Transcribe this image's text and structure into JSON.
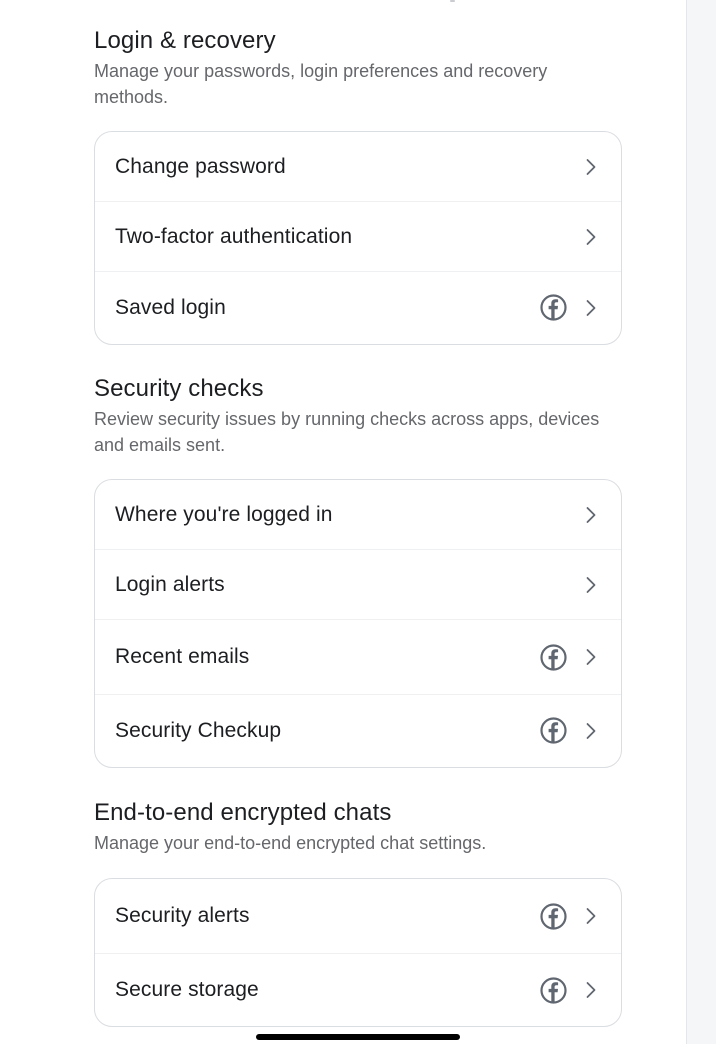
{
  "login_recovery": {
    "title": "Login & recovery",
    "description": "Manage your passwords, login preferences and recovery methods.",
    "items": [
      {
        "label": "Change password",
        "icon": "chevron-right-icon"
      },
      {
        "label": "Two-factor authentication",
        "icon": "chevron-right-icon"
      },
      {
        "label": "Saved login",
        "icon": "facebook-icon"
      }
    ]
  },
  "security_checks": {
    "title": "Security checks",
    "description": "Review security issues by running checks across apps, devices and emails sent.",
    "items": [
      {
        "label": "Where you're logged in",
        "icon": "chevron-right-icon"
      },
      {
        "label": "Login alerts",
        "icon": "chevron-right-icon"
      },
      {
        "label": "Recent emails",
        "icon": "facebook-icon"
      },
      {
        "label": "Security Checkup",
        "icon": "facebook-icon"
      }
    ]
  },
  "e2ee_chats": {
    "title": "End-to-end encrypted chats",
    "description": "Manage your end-to-end encrypted chat settings.",
    "items": [
      {
        "label": "Security alerts",
        "icon": "facebook-icon"
      },
      {
        "label": "Secure storage",
        "icon": "facebook-icon"
      }
    ]
  },
  "colors": {
    "text_primary": "#1c1e21",
    "text_secondary": "#65676b",
    "border": "#dadde1",
    "icon": "#606770"
  }
}
